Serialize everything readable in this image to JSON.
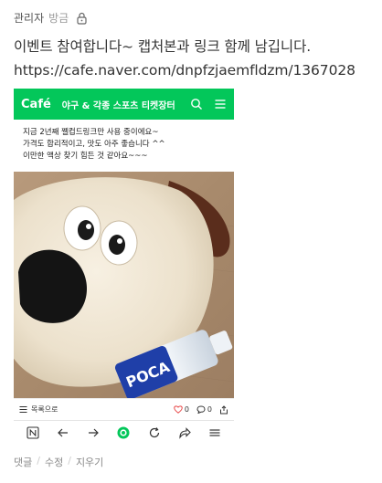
{
  "header": {
    "author": "관리자",
    "time": "방금"
  },
  "message": {
    "line1": "이벤트 참여합니다~ 캡처본과 링크 함께 남깁니다.",
    "line2": "https://cafe.naver.com/dnpfzjaemfldzm/1367028"
  },
  "screenshot": {
    "cafe_logo": "Café",
    "cafe_title": "야구 & 각종 스포츠 티켓장터",
    "post_lines": [
      "지금 2년째 쩰컵드링크만 사용 중이에요~",
      "가격도 합리적이고, 맛도 아주 좋습니다 ^^",
      "이만한 액상 찾기 힘든 것 같아요~~~"
    ],
    "bottle_label": "POCA",
    "list_label": "목록으로",
    "like_count": "0",
    "comment_count": "0"
  },
  "footer": {
    "reply": "댓글",
    "edit": "수정",
    "delete": "지우기"
  },
  "colors": {
    "accent": "#03c75a",
    "heart": "#e84a4a"
  }
}
